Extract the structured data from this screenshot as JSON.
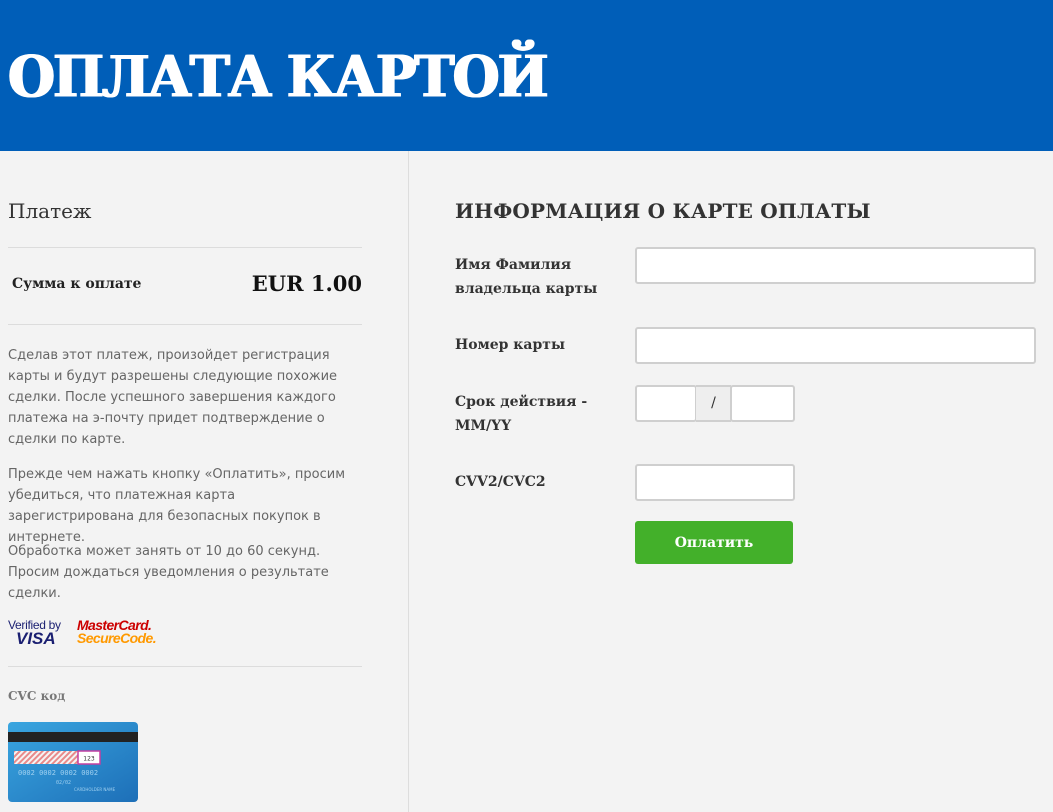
{
  "header": {
    "title": "ОПЛАТА КАРТОЙ"
  },
  "payment": {
    "section_title": "Платеж",
    "amount_label": "Сумма к оплате",
    "amount_value": "EUR 1.00",
    "description_1": "Сделав этот платеж, произойдет регистрация карты и будут разрешены следующие похожие сделки. После успешного завершения каждого платежа на э-почту придет подтверждение о сделки по карте.",
    "description_2": "Прежде чем нажать кнопку «Оплатить», просим убедиться, что платежная карта зарегистрирована для безопасных покупок в интернете.",
    "description_3": "Обработка может занять от 10 до 60 секунд. Просим дождаться уведомления о результате сделки.",
    "logos": {
      "verified_by_top": "Verified by",
      "verified_by_bottom": "VISA",
      "mastercard_top": "MasterCard.",
      "mastercard_bottom": "SecureCode."
    },
    "cvc_label": "CVC код",
    "cvc_card_example": {
      "code": "123",
      "number": "0002 0002 0002 0002",
      "expiry": "02/02",
      "name": "CARDHOLDER NAME"
    }
  },
  "form": {
    "title": "ИНФОРМАЦИЯ О КАРТЕ ОПЛАТЫ",
    "name_label_line1": "Имя Фамилия",
    "name_label_line2": "владельца карты",
    "name_value": "",
    "card_number_label": "Номер карты",
    "card_number_value": "",
    "expiry_label_line1": "Срок действия -",
    "expiry_label_line2": "MM/YY",
    "expiry_month_value": "",
    "expiry_separator": "/",
    "expiry_year_value": "",
    "cvv_label": "CVV2/CVC2",
    "cvv_value": "",
    "pay_button": "Оплатить"
  },
  "colors": {
    "header_bg": "#005eb8",
    "page_bg": "#f3f3f3",
    "button_bg": "#43b02a"
  }
}
